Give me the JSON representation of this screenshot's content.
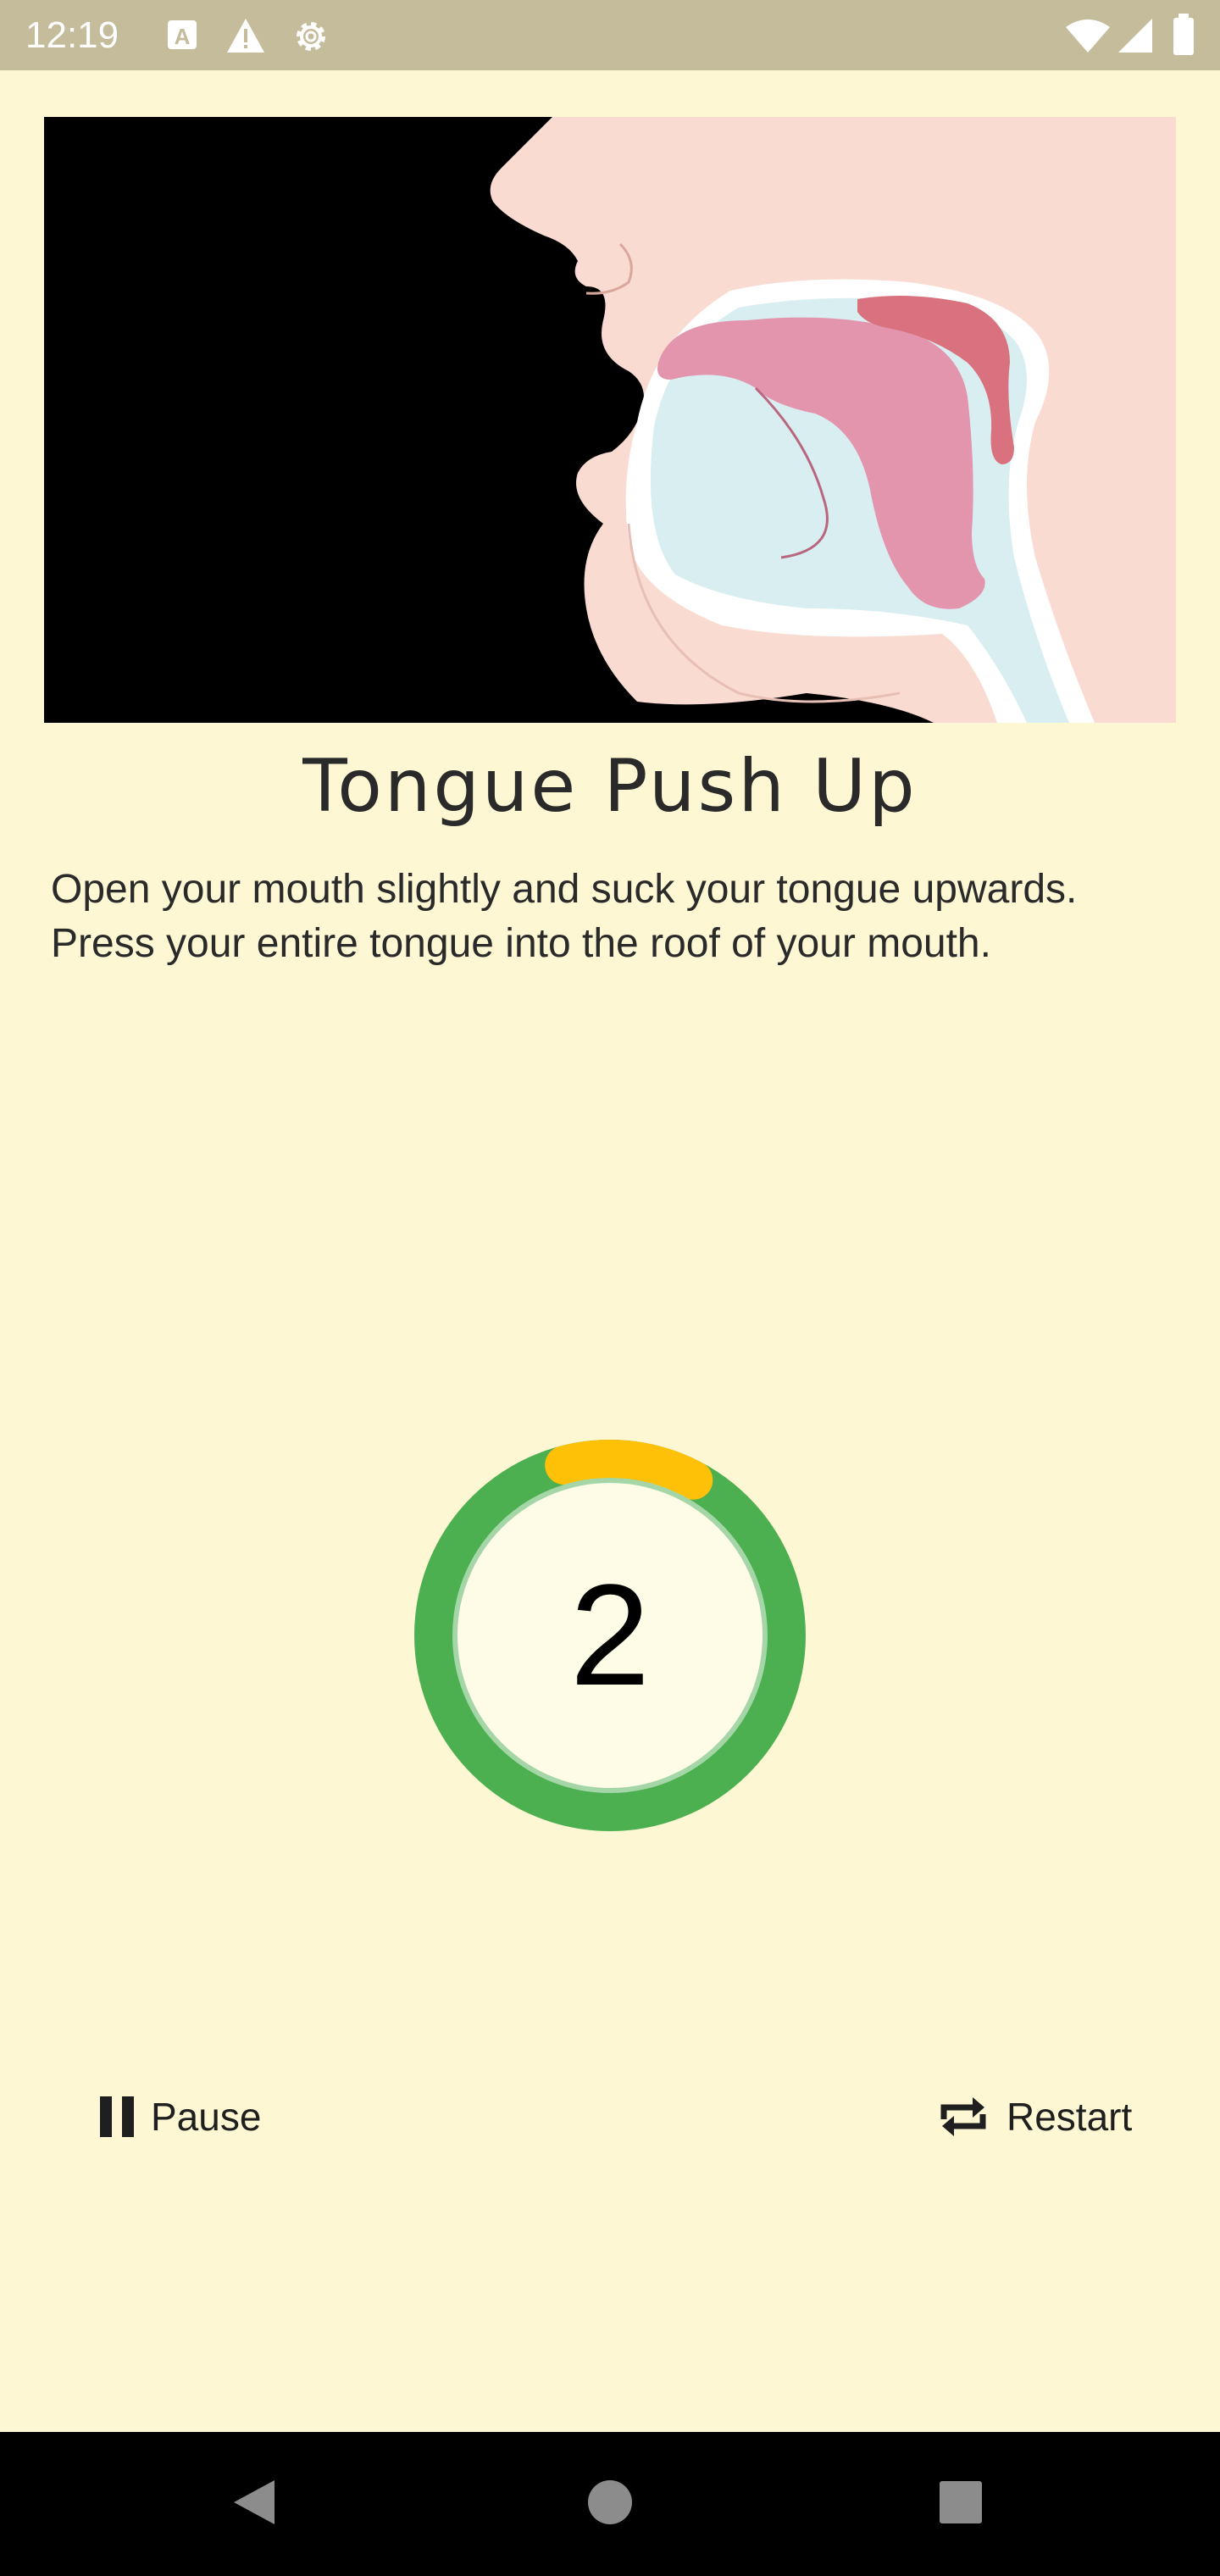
{
  "status_bar": {
    "time": "12:19",
    "left_icons": [
      "text-a-icon",
      "warning-icon",
      "settings-gear-icon"
    ],
    "right_icons": [
      "wifi-icon",
      "cell-signal-icon",
      "battery-icon"
    ]
  },
  "exercise": {
    "illustration_icon": "mouth-tongue-diagram",
    "title": "Tongue Push Up",
    "description": "Open your mouth slightly and suck your tongue upwards. Press your entire tongue into the roof of your mouth."
  },
  "timer": {
    "count": "2",
    "ring_color": "#4CAF50",
    "progress_color": "#FFC107",
    "progress_fraction": 0.12
  },
  "controls": {
    "pause_label": "Pause",
    "pause_icon": "pause-icon",
    "restart_label": "Restart",
    "restart_icon": "repeat-icon"
  },
  "nav_bar": {
    "buttons": [
      "back-icon",
      "home-icon",
      "recents-icon"
    ]
  }
}
